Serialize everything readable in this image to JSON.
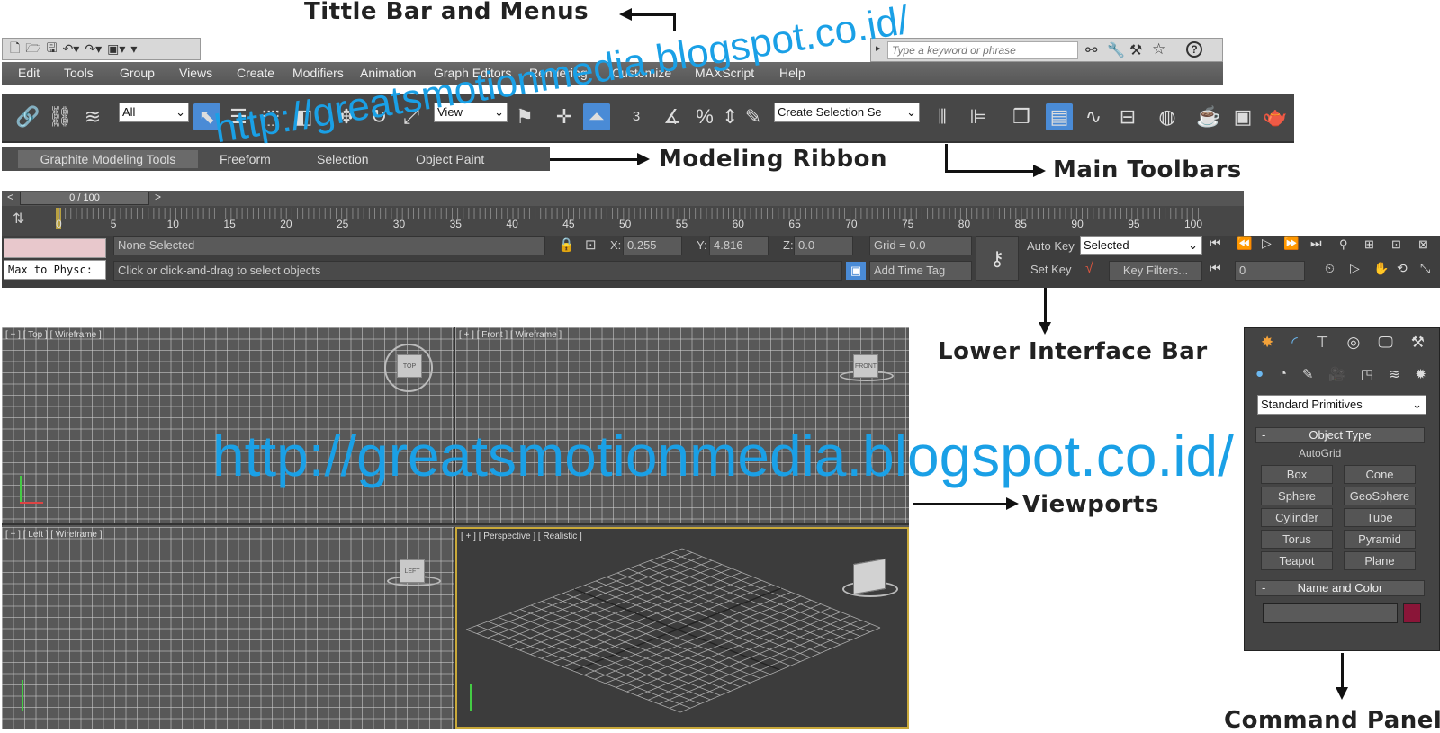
{
  "annotations": {
    "title_bar": "Tittle Bar and Menus",
    "modeling_ribbon": "Modeling Ribbon",
    "main_toolbars": "Main Toolbars",
    "lower_interface_bar": "Lower Interface Bar",
    "viewports": "Viewports",
    "command_panel": "Command Panel"
  },
  "watermark": "http://greatsmotionmedia.blogspot.co.id/",
  "infocenter": {
    "search_placeholder": "Type a keyword or phrase",
    "help": "?"
  },
  "menu": [
    "Edit",
    "Tools",
    "Group",
    "Views",
    "Create",
    "Modifiers",
    "Animation",
    "Graph Editors",
    "Rendering",
    "Customize",
    "MAXScript",
    "Help"
  ],
  "toolbar": {
    "selection_filter": "All",
    "ref_coord": "View",
    "snap_label": "3",
    "named_selection": "Create Selection Se"
  },
  "ribbon": {
    "tabs": [
      "Graphite Modeling Tools",
      "Freeform",
      "Selection",
      "Object Paint"
    ]
  },
  "timeline": {
    "frame_counter": "0 / 100",
    "prev": "<",
    "next": ">",
    "ticks": [
      "5",
      "10",
      "15",
      "20",
      "25",
      "30",
      "35",
      "40",
      "45",
      "50",
      "55",
      "60",
      "65",
      "70",
      "75",
      "80",
      "85",
      "90",
      "95",
      "100"
    ],
    "start_marker": "0"
  },
  "lower": {
    "maxscript_listener": "Max to Physc:",
    "selection_status": "None Selected",
    "prompt": "Click or click-and-drag to select objects",
    "x_label": "X:",
    "x_value": "0.255",
    "y_label": "Y:",
    "y_value": "4.816",
    "z_label": "Z:",
    "z_value": "0.0",
    "grid": "Grid = 0.0",
    "add_time_tag": "Add Time Tag",
    "auto_key": "Auto Key",
    "set_key": "Set Key",
    "key_mode": "Selected",
    "key_filters": "Key Filters...",
    "current_frame": "0"
  },
  "viewports": {
    "top": "[ + ] [ Top ] [ Wireframe ]",
    "front": "[ + ] [ Front ] [ Wireframe ]",
    "left": "[ + ] [ Left ] [ Wireframe ]",
    "perspective": "[ + ] [ Perspective ] [ Realistic ]",
    "cube_top": "TOP",
    "cube_front": "FRONT",
    "cube_left": "LEFT"
  },
  "command_panel": {
    "category": "Standard Primitives",
    "object_type_header": "Object Type",
    "autogrid": "AutoGrid",
    "buttons": [
      "Box",
      "Cone",
      "Sphere",
      "GeoSphere",
      "Cylinder",
      "Tube",
      "Torus",
      "Pyramid",
      "Teapot",
      "Plane"
    ],
    "name_color_header": "Name and Color",
    "collapse": "-",
    "color_swatch": "#8a1538"
  }
}
